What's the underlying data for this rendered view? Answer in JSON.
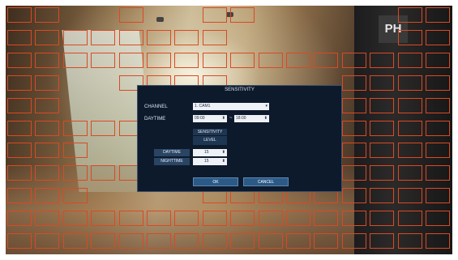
{
  "camera_feed": {
    "sign_text": "PH"
  },
  "motion_grid": {
    "accent_color": "#d94a24"
  },
  "dialog": {
    "title": "SENSITIVITY",
    "channel_label": "CHANNEL",
    "channel_value": "1. CAM1",
    "daytime_label": "DAYTIME",
    "daytime_start": "09:00",
    "daytime_end": "18:00",
    "range_separator": "~",
    "table": {
      "header_line1": "SENSITIVITY",
      "header_line2": "LEVEL",
      "rows": [
        {
          "label": "DAYTIME",
          "value": "15"
        },
        {
          "label": "NIGHTTIME",
          "value": "15"
        }
      ]
    },
    "ok_label": "OK",
    "cancel_label": "CANCEL"
  }
}
